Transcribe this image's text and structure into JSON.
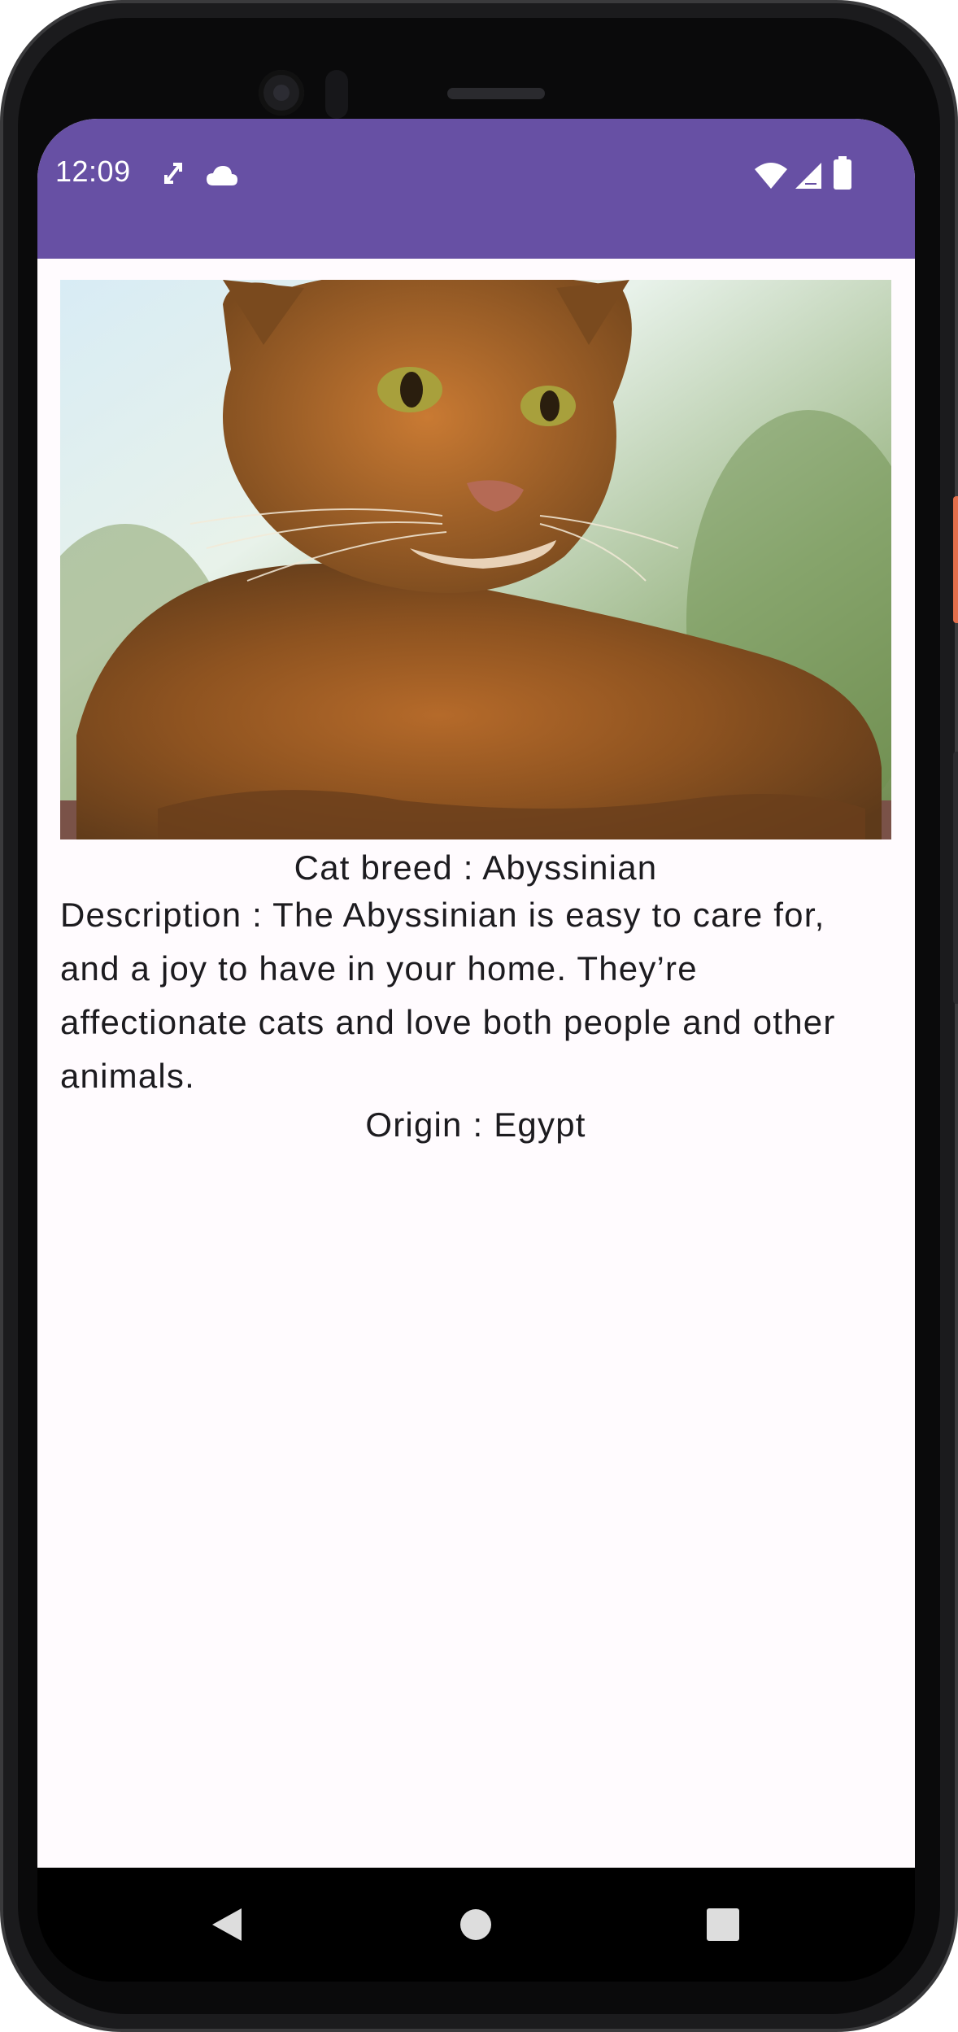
{
  "status_bar": {
    "time": "12:09",
    "left_icons": [
      "sync-arrows-icon",
      "cloud-icon"
    ],
    "right_icons": [
      "wifi-icon",
      "cellular-signal-icon",
      "battery-icon"
    ],
    "color": "#6750a4"
  },
  "content": {
    "image": "abyssinian-cat-photo",
    "breed": "Cat breed : Abyssinian",
    "description": "Description : The Abyssinian is easy to care for, and a joy to have in your home. They’re affectionate cats and love both people and other animals.",
    "origin": "Origin : Egypt"
  },
  "nav_bar": {
    "buttons": [
      "back-icon",
      "home-icon",
      "recents-icon"
    ]
  }
}
